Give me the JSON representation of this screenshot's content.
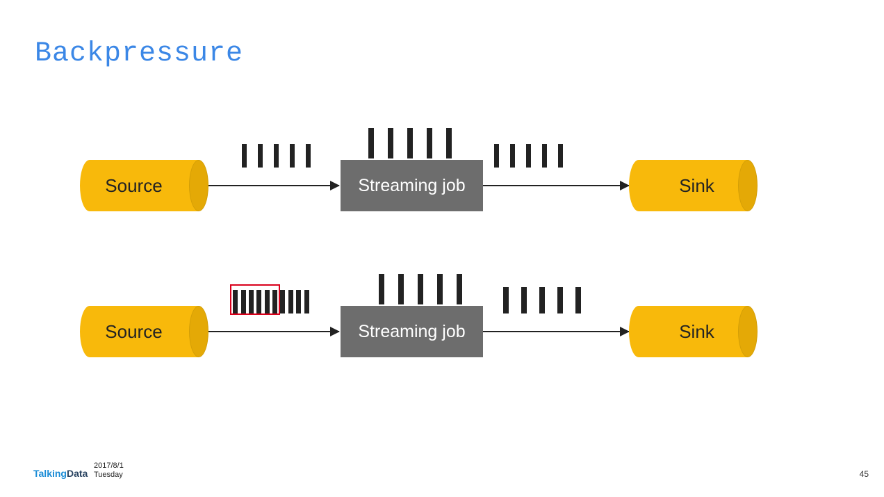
{
  "title": "Backpressure",
  "diagram": {
    "source_label": "Source",
    "sink_label": "Sink",
    "job_label": "Streaming job",
    "rows": [
      {
        "left_ticks": {
          "count": 5,
          "style": "thin",
          "highlighted": false
        },
        "center_ticks": {
          "count": 5,
          "style": "tall"
        },
        "right_ticks": {
          "count": 5,
          "style": "thin"
        }
      },
      {
        "left_ticks": {
          "count": 10,
          "style": "packed",
          "highlighted": true,
          "highlight_color": "#d9001b"
        },
        "center_ticks": {
          "count": 5,
          "style": "tall"
        },
        "right_ticks": {
          "count": 5,
          "style": "mid"
        }
      }
    ]
  },
  "footer": {
    "logo_a": "Talking",
    "logo_b": "Data",
    "date": "2017/8/1",
    "day": "Tuesday",
    "page": "45"
  }
}
